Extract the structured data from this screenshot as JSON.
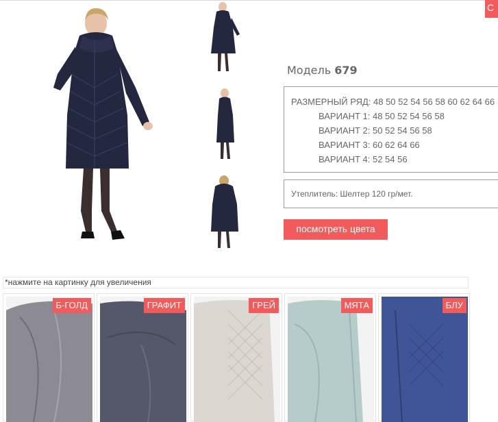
{
  "top_button_label": "С",
  "model": {
    "prefix": "Модель",
    "number": "679"
  },
  "sizes": {
    "range": "РАЗМЕРНЫЙ РЯД: 48 50 52 54 56 58 60 62 64 66",
    "variants": [
      "ВАРИАНТ 1: 48 50 52 54 56 58",
      "ВАРИАНТ 2: 50 52 54 56 58",
      "ВАРИАНТ 3: 60 62 64 66",
      "ВАРИАНТ 4: 52 54 56"
    ]
  },
  "insulation": "Утеплитель: Шелтер 120 гр/мет.",
  "view_colors_button": "посмотреть цвета",
  "hint": "*нажмите на картинку для увеличения",
  "colors": [
    {
      "label": "Б-ГОЛД",
      "hex": "#8c8b94"
    },
    {
      "label": "ГРАФИТ",
      "hex": "#55586a"
    },
    {
      "label": "ГРЕЙ",
      "hex": "#dcd7d0"
    },
    {
      "label": "МЯТА",
      "hex": "#b5cccb"
    },
    {
      "label": "БЛУ",
      "hex": "#3f5597"
    }
  ],
  "accent": "#f15b5b",
  "coat_color": "#232840"
}
